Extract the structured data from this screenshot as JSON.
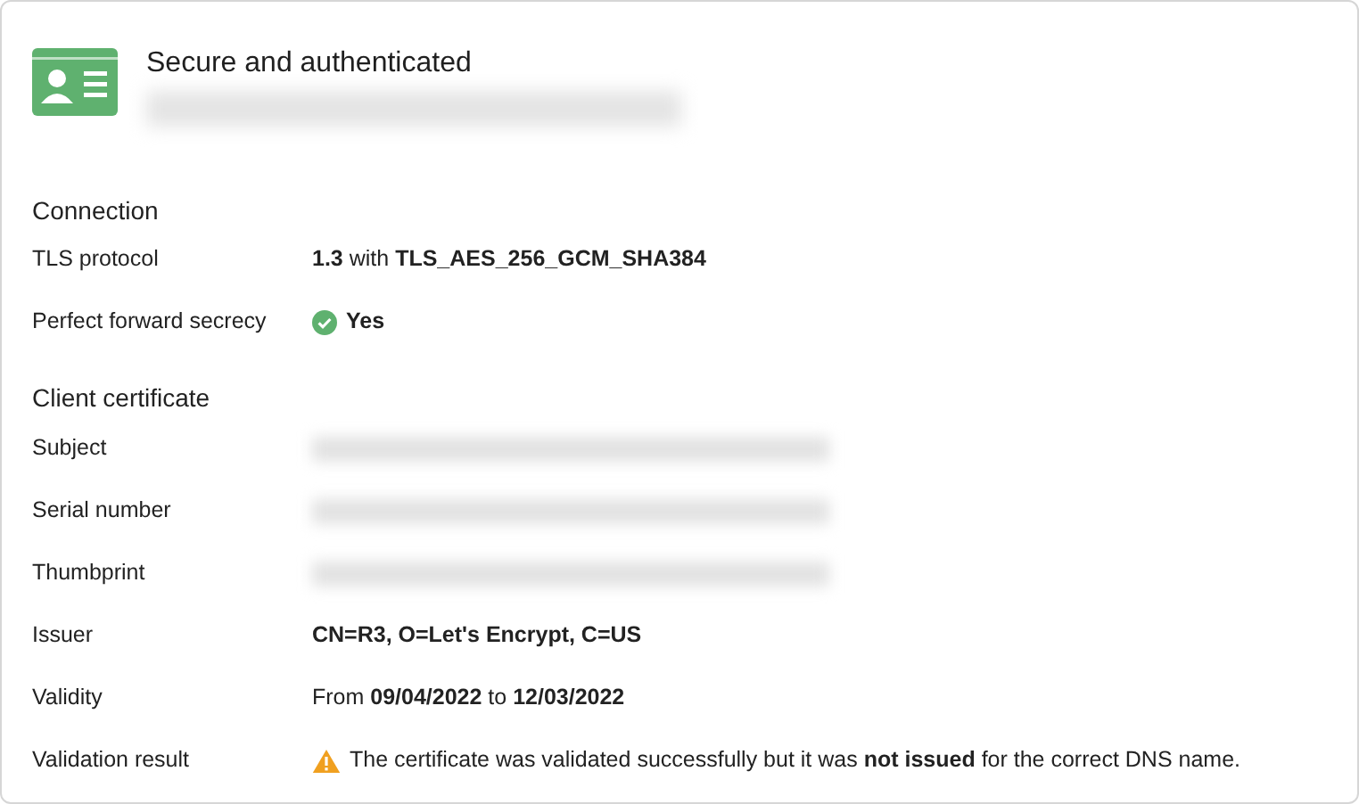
{
  "header": {
    "title": "Secure and authenticated",
    "subtitle_redacted": true
  },
  "sections": [
    {
      "title": "Connection",
      "rows": [
        {
          "label": "TLS protocol",
          "kind": "text",
          "value": "**1.3** with **TLS_AES_256_GCM_SHA384**"
        },
        {
          "label": "Perfect forward secrecy",
          "kind": "check",
          "value": "**Yes**"
        }
      ]
    },
    {
      "title": "Client certificate",
      "rows": [
        {
          "label": "Subject",
          "kind": "redacted"
        },
        {
          "label": "Serial number",
          "kind": "redacted"
        },
        {
          "label": "Thumbprint",
          "kind": "redacted"
        },
        {
          "label": "Issuer",
          "kind": "text",
          "value": "**CN=R3, O=Let's Encrypt, C=US**"
        },
        {
          "label": "Validity",
          "kind": "text",
          "value": "From **09/04/2022** to **12/03/2022**"
        },
        {
          "label": "Validation result",
          "kind": "warning",
          "value": "The certificate was validated successfully but it was **not issued** for the correct DNS name."
        }
      ]
    }
  ]
}
